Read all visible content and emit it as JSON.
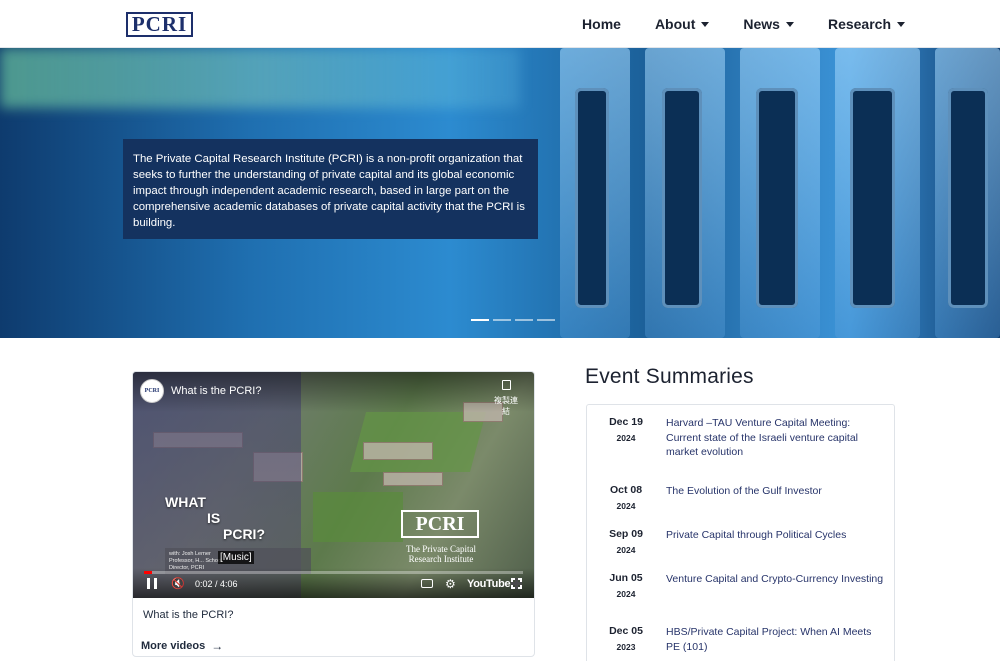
{
  "nav": {
    "logo_text": "PCRI",
    "items": [
      {
        "label": "Home",
        "has_dropdown": false
      },
      {
        "label": "About",
        "has_dropdown": true
      },
      {
        "label": "News",
        "has_dropdown": true
      },
      {
        "label": "Research",
        "has_dropdown": true
      }
    ]
  },
  "hero": {
    "caption": "The Private Capital Research Institute (PCRI) is a non-profit organization that seeks to further the understanding of private capital and its global economic impact through independent academic research, based in large part on the comprehensive academic databases of private capital activity that the PCRI is building.",
    "slides": 4,
    "active_slide": 1
  },
  "video": {
    "title": "What is the PCRI?",
    "copy_link_label": "複製連結",
    "overlay_line1": "WHAT",
    "overlay_line2": "IS",
    "overlay_line3": "PCRI?",
    "logo_text": "PCRI",
    "logo_subtitle_1": "The Private Capital",
    "logo_subtitle_2": "Research Institute",
    "credit_line1": "with: Josh Lerner",
    "credit_line2": "Professor, H... School",
    "credit_line3": "Director, PCRI",
    "subtitle": "[Music]",
    "time": "0:02 / 4:06",
    "progress_fraction": 0.008,
    "youtube_label": "YouTube",
    "caption": "What is the PCRI?",
    "more_label": "More videos"
  },
  "events": {
    "heading": "Event Summaries",
    "items": [
      {
        "month_day": "Dec 19",
        "year": "2024",
        "title": "Harvard –TAU Venture Capital Meeting: Current state of the Israeli venture capital market evolution"
      },
      {
        "month_day": "Oct 08",
        "year": "2024",
        "title": "The Evolution of the Gulf Investor"
      },
      {
        "month_day": "Sep 09",
        "year": "2024",
        "title": "Private Capital through Political Cycles"
      },
      {
        "month_day": "Jun 05",
        "year": "2024",
        "title": "Venture Capital and Crypto-Currency Investing"
      },
      {
        "month_day": "Dec 05",
        "year": "2023",
        "title": "HBS/Private Capital Project: When AI Meets PE (101)"
      }
    ]
  }
}
